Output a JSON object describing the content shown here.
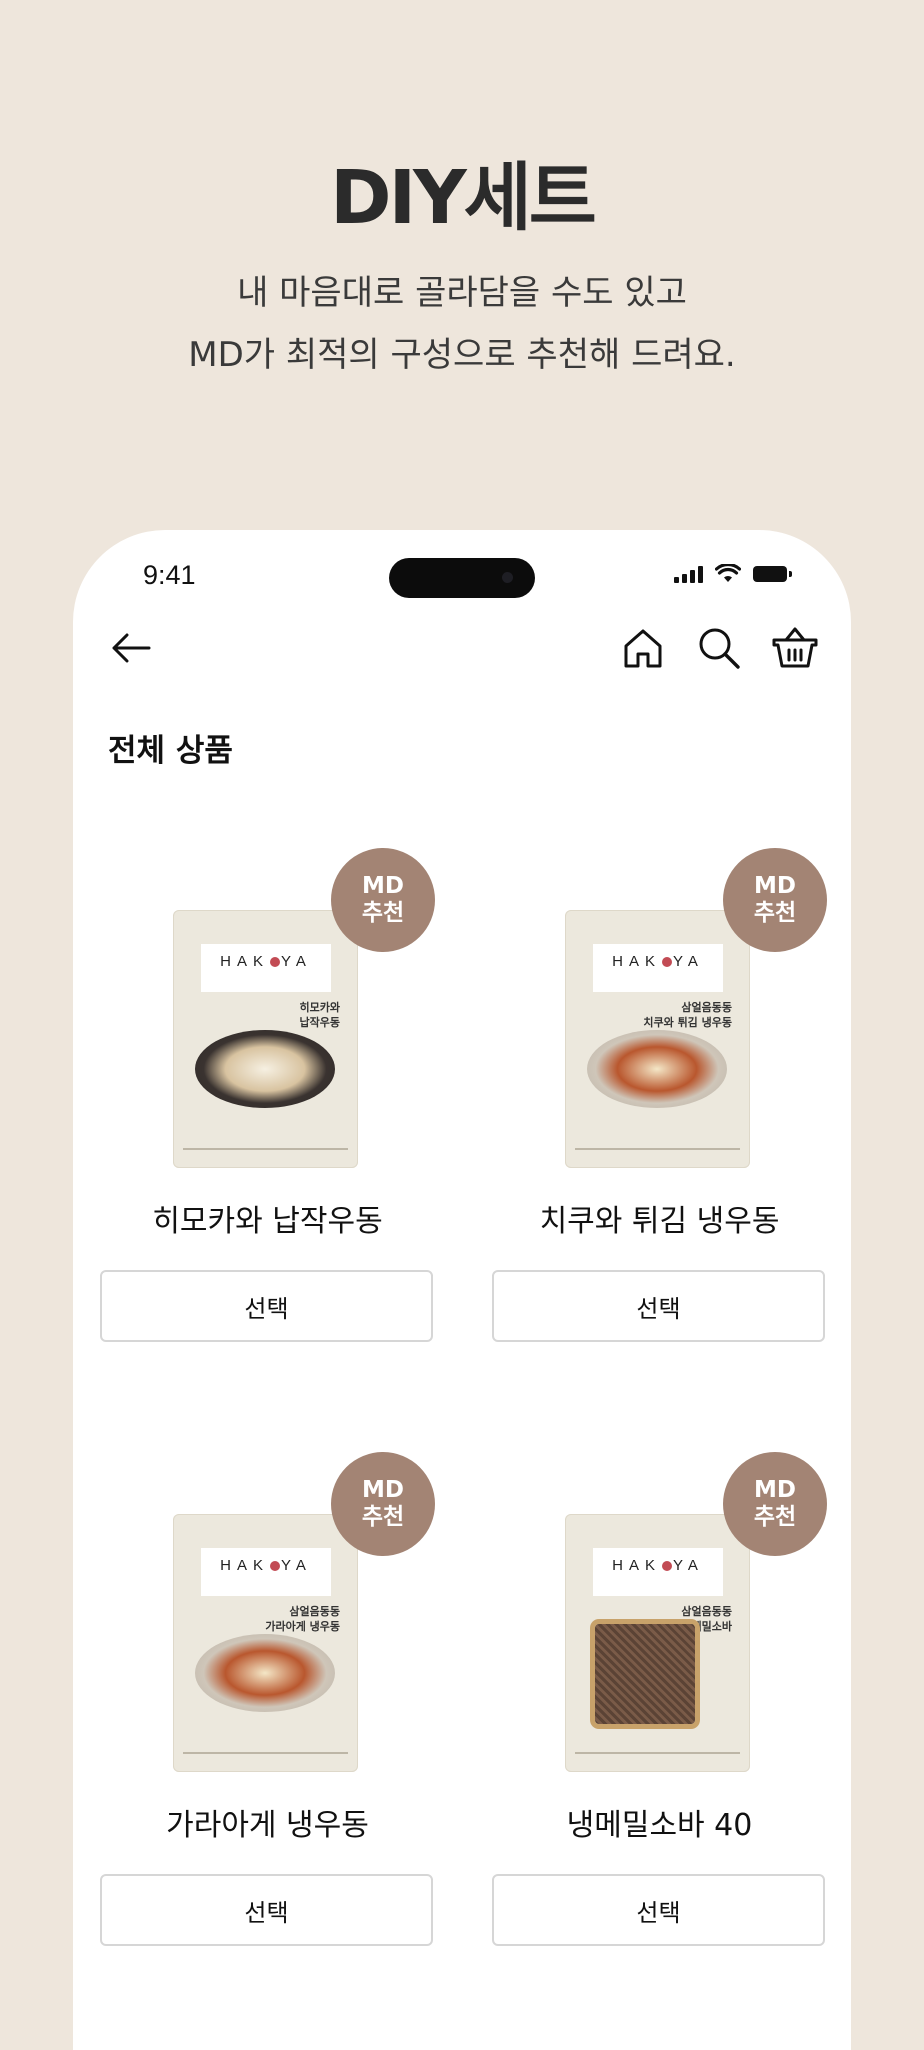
{
  "hero": {
    "title": "DIY세트",
    "subtitle_line1": "내 마음대로 골라담을 수도 있고",
    "subtitle_line2": "MD가 최적의 구성으로 추천해 드려요."
  },
  "status_bar": {
    "time": "9:41"
  },
  "nav": {
    "back_icon": "arrow-left-icon",
    "home_icon": "home-icon",
    "search_icon": "search-icon",
    "cart_icon": "basket-icon"
  },
  "section": {
    "title": "전체 상품"
  },
  "products": [
    {
      "name": "히모카와 납작우동",
      "badge_line1": "MD",
      "badge_line2": "추천",
      "select_label": "선택",
      "pack_brand": "HAKOYA",
      "pack_label": "히모카와\n납작우동"
    },
    {
      "name": "치쿠와 튀김 냉우동",
      "badge_line1": "MD",
      "badge_line2": "추천",
      "select_label": "선택",
      "pack_brand": "HAKOYA",
      "pack_label": "삼얼음동동\n치쿠와 튀김 냉우동"
    },
    {
      "name": "가라아게 냉우동",
      "badge_line1": "MD",
      "badge_line2": "추천",
      "select_label": "선택",
      "pack_brand": "HAKOYA",
      "pack_label": "삼얼음동동\n가라아게 냉우동"
    },
    {
      "name": "냉메밀소바 40",
      "badge_line1": "MD",
      "badge_line2": "추천",
      "select_label": "선택",
      "pack_brand": "HAKOYA",
      "pack_label": "삼얼음동동\n냉메밀소바"
    }
  ],
  "colors": {
    "background": "#EEE6DC",
    "badge": "#A38474",
    "button_border": "#D6D6D6"
  }
}
